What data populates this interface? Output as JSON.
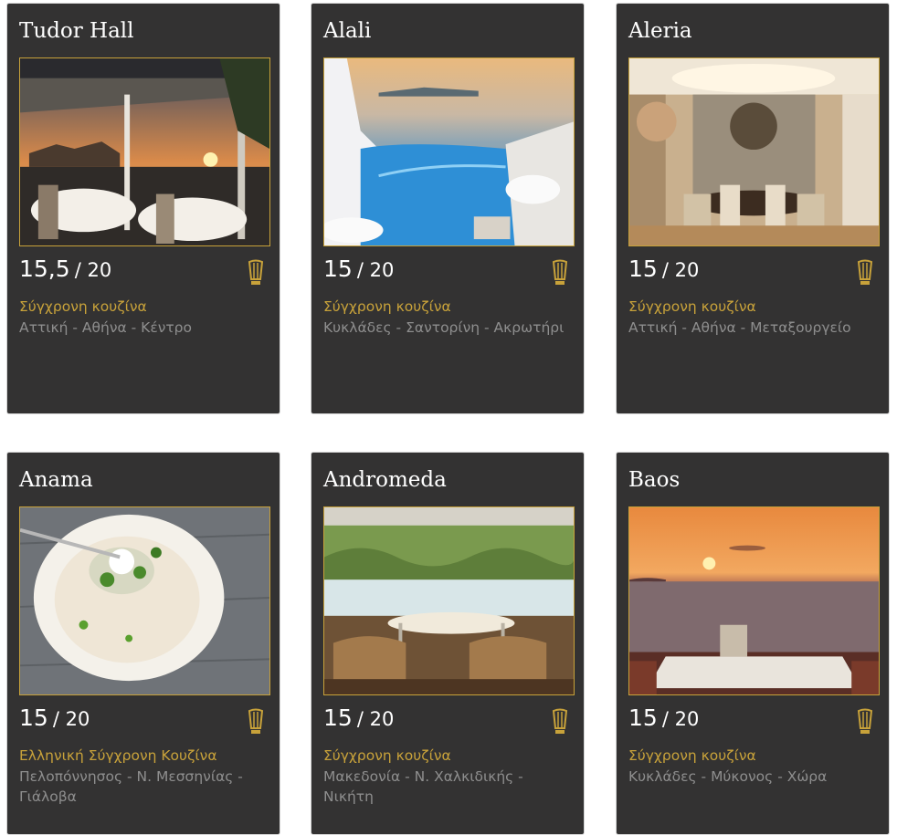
{
  "restaurants": [
    {
      "name": "Tudor Hall",
      "score": "15,5",
      "out_of": "/ 20",
      "cuisine": "Σύγχρονη κουζίνα",
      "location": "Αττική - Αθήνα - Κέντρο",
      "award_icon": "toque-icon"
    },
    {
      "name": "Alali",
      "score": "15",
      "out_of": "/ 20",
      "cuisine": "Σύγχρονη κουζίνα",
      "location": "Κυκλάδες - Σαντορίνη - Ακρωτήρι",
      "award_icon": "toque-icon"
    },
    {
      "name": "Aleria",
      "score": "15",
      "out_of": "/ 20",
      "cuisine": "Σύγχρονη κουζίνα",
      "location": "Αττική - Αθήνα - Μεταξουργείο",
      "award_icon": "toque-icon"
    },
    {
      "name": "Anama",
      "score": "15",
      "out_of": "/ 20",
      "cuisine": "Ελληνική Σύγχρονη Κουζίνα",
      "location": "Πελοπόννησος - Ν. Μεσσηνίας - Γιάλοβα",
      "award_icon": "toque-icon"
    },
    {
      "name": "Andromeda",
      "score": "15",
      "out_of": "/ 20",
      "cuisine": "Σύγχρονη κουζίνα",
      "location": "Μακεδονία - Ν. Χαλκιδικής - Νικήτη",
      "award_icon": "toque-icon"
    },
    {
      "name": "Baos",
      "score": "15",
      "out_of": "/ 20",
      "cuisine": "Σύγχρονη κουζίνα",
      "location": "Κυκλάδες - Μύκονος - Χώρα",
      "award_icon": "toque-icon"
    }
  ],
  "colors": {
    "card_bg": "#333232",
    "accent": "#c8a23a",
    "muted": "#8e8e8e",
    "text": "#ffffff"
  }
}
